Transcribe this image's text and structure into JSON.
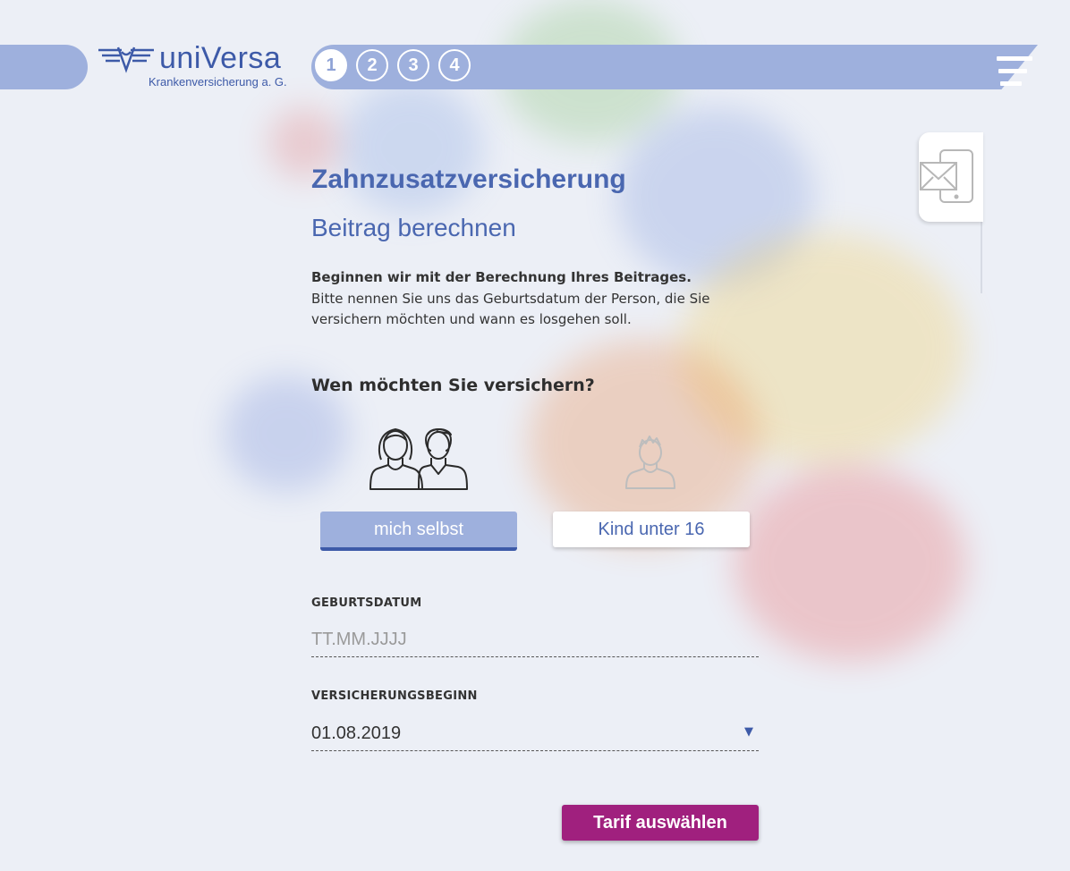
{
  "brand": {
    "name": "uniVersa",
    "subtitle": "Krankenversicherung a. G.",
    "color": "#3d5aa8"
  },
  "steps": [
    {
      "label": "1",
      "active": true
    },
    {
      "label": "2",
      "active": false
    },
    {
      "label": "3",
      "active": false
    },
    {
      "label": "4",
      "active": false
    }
  ],
  "icons": {
    "menu": "hamburger-menu-icon",
    "contact": "mail-phone-icon",
    "adults": "adults-icon",
    "child": "child-icon",
    "dropdown": "chevron-down-icon"
  },
  "page": {
    "title": "Zahnzusatzversicherung",
    "subtitle": "Beitrag berechnen",
    "intro_bold": "Beginnen wir mit der Berechnung Ihres Beitrages.",
    "intro_text": "Bitte nennen Sie uns das Geburtsdatum der Person, die Sie versichern möchten und wann es losgehen soll.",
    "question": "Wen möchten Sie versichern?"
  },
  "options": {
    "self_label": "mich selbst",
    "child_label": "Kind unter 16",
    "selected": "self"
  },
  "form": {
    "birthdate_label": "GEBURTSDATUM",
    "birthdate_placeholder": "TT.MM.JJJJ",
    "start_label": "VERSICHERUNGSBEGINN",
    "start_value": "01.08.2019"
  },
  "actions": {
    "submit_label": "Tarif auswählen"
  },
  "colors": {
    "accent": "#4a67b0",
    "bar": "#9eb0dd",
    "submit": "#a0207e",
    "background": "#eceff6"
  }
}
